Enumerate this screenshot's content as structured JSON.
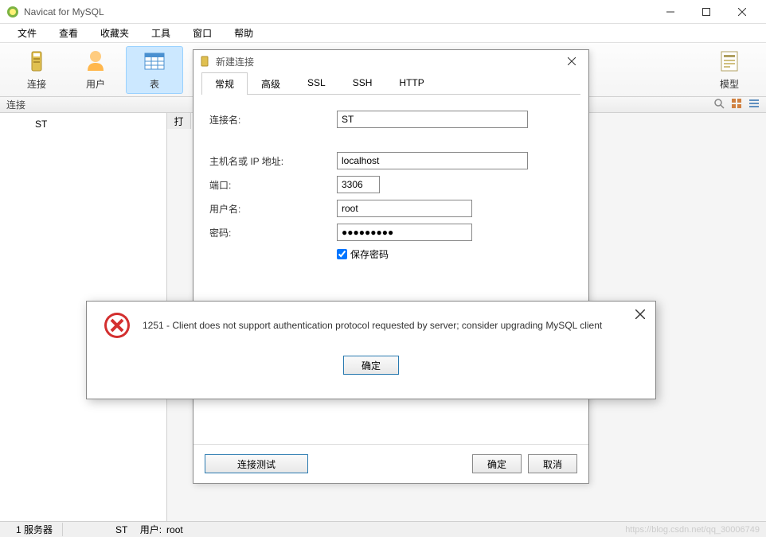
{
  "window": {
    "title": "Navicat for MySQL"
  },
  "menu": {
    "items": [
      "文件",
      "查看",
      "收藏夹",
      "工具",
      "窗口",
      "帮助"
    ]
  },
  "toolbar": {
    "items": [
      {
        "label": "连接",
        "icon": "connection-icon"
      },
      {
        "label": "用户",
        "icon": "user-icon"
      },
      {
        "label": "表",
        "icon": "table-icon",
        "active": true
      },
      {
        "label": "模型",
        "icon": "model-icon"
      }
    ]
  },
  "panel": {
    "connection_label": "连接",
    "content_strip": "打"
  },
  "tree": {
    "items": [
      {
        "label": "ST"
      }
    ]
  },
  "dialog": {
    "title": "新建连接",
    "tabs": [
      "常规",
      "高级",
      "SSL",
      "SSH",
      "HTTP"
    ],
    "form": {
      "connection_name_label": "连接名:",
      "connection_name_value": "ST",
      "host_label": "主机名或 IP 地址:",
      "host_value": "localhost",
      "port_label": "端口:",
      "port_value": "3306",
      "username_label": "用户名:",
      "username_value": "root",
      "password_label": "密码:",
      "password_value": "●●●●●●●●●",
      "save_password_label": "保存密码"
    },
    "buttons": {
      "test": "连接测试",
      "ok": "确定",
      "cancel": "取消"
    }
  },
  "error": {
    "message": "1251 - Client does not support authentication protocol requested by server; consider upgrading MySQL client",
    "ok": "确定"
  },
  "status": {
    "servers": "1 服务器",
    "current": "ST",
    "user_label": "用户:",
    "user_value": "root"
  },
  "watermark": "https://blog.csdn.net/qq_30006749"
}
